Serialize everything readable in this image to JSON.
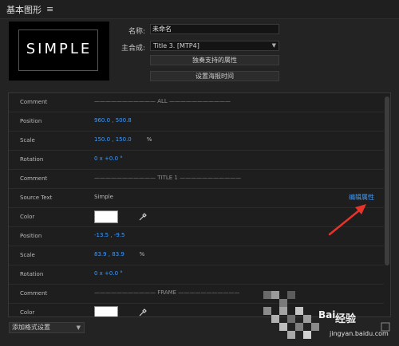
{
  "panel": {
    "title": "基本图形",
    "menu_glyph": "≡"
  },
  "thumbnail": {
    "text": "SIMPLE"
  },
  "fields": {
    "name_label": "名称:",
    "name_value": "未命名",
    "comp_label": "主合成:",
    "comp_value": "Title 3. [MTP4]",
    "solo_button": "独奏支持的属性",
    "poster_button": "设置海报时间"
  },
  "rows": [
    {
      "name": "Comment",
      "value": "——————————— ALL ———————————",
      "kind": "divider"
    },
    {
      "name": "Position",
      "value": "960.0 , 500.8",
      "kind": "blue"
    },
    {
      "name": "Scale",
      "value": "150.0 , 150.0",
      "unit": "%",
      "kind": "blue-unit"
    },
    {
      "name": "Rotation",
      "value": "0 x +0.0 °",
      "kind": "blue"
    },
    {
      "name": "Comment",
      "value": "——————————— TITLE 1 ———————————",
      "kind": "divider"
    },
    {
      "name": "Source Text",
      "value": "Simple",
      "kind": "text",
      "link": "编辑属性"
    },
    {
      "name": "Color",
      "kind": "color",
      "color": "#ffffff"
    },
    {
      "name": "Position",
      "value": "-13.5 , -9.5",
      "kind": "blue"
    },
    {
      "name": "Scale",
      "value": "83.9 , 83.9",
      "unit": "%",
      "kind": "blue-unit"
    },
    {
      "name": "Rotation",
      "value": "0 x +0.0 °",
      "kind": "blue"
    },
    {
      "name": "Comment",
      "value": "——————————— FRAME ———————————",
      "kind": "divider"
    },
    {
      "name": "Color",
      "kind": "color",
      "color": "#ffffff"
    }
  ],
  "footer": {
    "add_style": "添加格式设置"
  },
  "watermark": {
    "badge": "Bai",
    "brand": "经验",
    "url": "jingyan.baidu.com"
  },
  "colors": {
    "accent": "#3f9bff",
    "arrow": "#e8332a"
  }
}
